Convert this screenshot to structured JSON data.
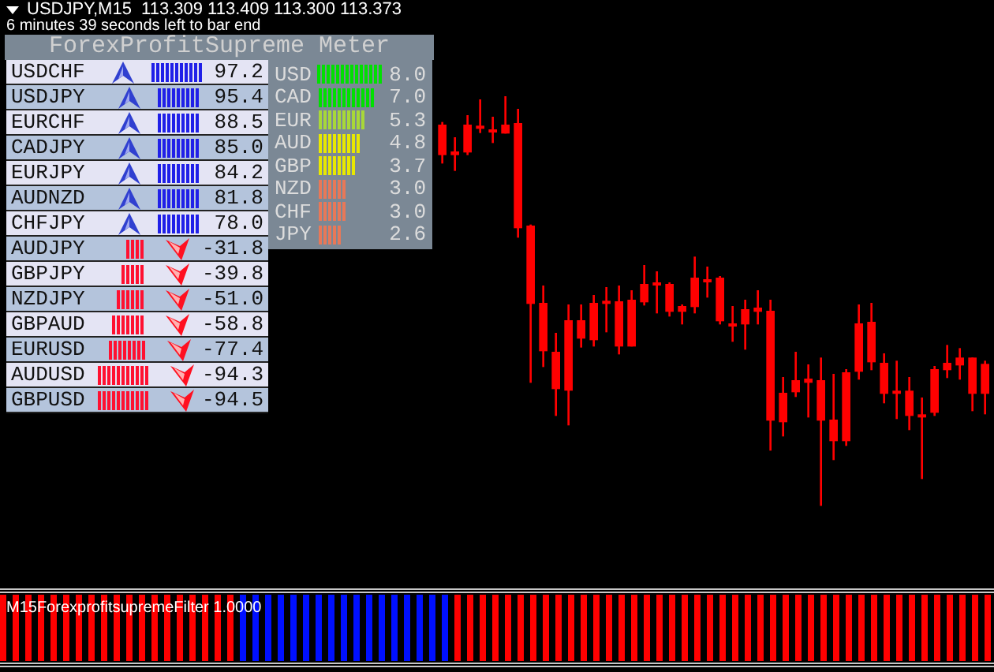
{
  "header": {
    "symbol_line": "USDJPY,M15  113.309 113.409 113.300 113.373",
    "countdown": "6 minutes 39 seconds left to bar end"
  },
  "meter": {
    "title": "ForexProfitSupreme Meter",
    "pairs": [
      {
        "name": "USDCHF",
        "kind": "up",
        "value": "97.2"
      },
      {
        "name": "USDJPY",
        "kind": "up",
        "value": "95.4"
      },
      {
        "name": "EURCHF",
        "kind": "up",
        "value": "88.5"
      },
      {
        "name": "CADJPY",
        "kind": "up",
        "value": "85.0"
      },
      {
        "name": "EURJPY",
        "kind": "up",
        "value": "84.2"
      },
      {
        "name": "AUDNZD",
        "kind": "up",
        "value": "81.8"
      },
      {
        "name": "CHFJPY",
        "kind": "up",
        "value": "78.0"
      },
      {
        "name": "AUDJPY",
        "kind": "down",
        "value": "-31.8"
      },
      {
        "name": "GBPJPY",
        "kind": "down",
        "value": "-39.8"
      },
      {
        "name": "NZDJPY",
        "kind": "down",
        "value": "-51.0"
      },
      {
        "name": "GBPAUD",
        "kind": "down",
        "value": "-58.8"
      },
      {
        "name": "EURUSD",
        "kind": "down",
        "value": "-77.4"
      },
      {
        "name": "AUDUSD",
        "kind": "down",
        "value": "-94.3"
      },
      {
        "name": "GBPUSD",
        "kind": "down",
        "value": "-94.5"
      }
    ],
    "currencies": [
      {
        "name": "USD",
        "color": "#00e000",
        "value": "8.0"
      },
      {
        "name": "CAD",
        "color": "#00e000",
        "value": "7.0"
      },
      {
        "name": "EUR",
        "color": "#a8d838",
        "value": "5.3"
      },
      {
        "name": "AUD",
        "color": "#e8e800",
        "value": "4.8"
      },
      {
        "name": "GBP",
        "color": "#e8e800",
        "value": "3.7"
      },
      {
        "name": "NZD",
        "color": "#e87858",
        "value": "3.0"
      },
      {
        "name": "CHF",
        "color": "#e87858",
        "value": "3.0"
      },
      {
        "name": "JPY",
        "color": "#e87858",
        "value": "2.6"
      }
    ]
  },
  "indicator": {
    "label": "M15ForexprofitsupremeFilter 1.0000"
  }
}
